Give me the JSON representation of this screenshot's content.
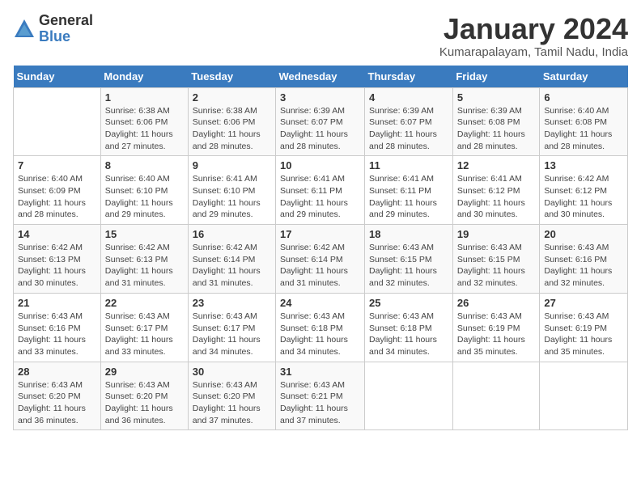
{
  "logo": {
    "text1": "General",
    "text2": "Blue"
  },
  "title": "January 2024",
  "location": "Kumarapalayam, Tamil Nadu, India",
  "weekdays": [
    "Sunday",
    "Monday",
    "Tuesday",
    "Wednesday",
    "Thursday",
    "Friday",
    "Saturday"
  ],
  "days": [
    {
      "date": "",
      "sunrise": "",
      "sunset": "",
      "daylight": ""
    },
    {
      "date": "1",
      "sunrise": "Sunrise: 6:38 AM",
      "sunset": "Sunset: 6:06 PM",
      "daylight": "Daylight: 11 hours and 27 minutes."
    },
    {
      "date": "2",
      "sunrise": "Sunrise: 6:38 AM",
      "sunset": "Sunset: 6:06 PM",
      "daylight": "Daylight: 11 hours and 28 minutes."
    },
    {
      "date": "3",
      "sunrise": "Sunrise: 6:39 AM",
      "sunset": "Sunset: 6:07 PM",
      "daylight": "Daylight: 11 hours and 28 minutes."
    },
    {
      "date": "4",
      "sunrise": "Sunrise: 6:39 AM",
      "sunset": "Sunset: 6:07 PM",
      "daylight": "Daylight: 11 hours and 28 minutes."
    },
    {
      "date": "5",
      "sunrise": "Sunrise: 6:39 AM",
      "sunset": "Sunset: 6:08 PM",
      "daylight": "Daylight: 11 hours and 28 minutes."
    },
    {
      "date": "6",
      "sunrise": "Sunrise: 6:40 AM",
      "sunset": "Sunset: 6:08 PM",
      "daylight": "Daylight: 11 hours and 28 minutes."
    },
    {
      "date": "7",
      "sunrise": "Sunrise: 6:40 AM",
      "sunset": "Sunset: 6:09 PM",
      "daylight": "Daylight: 11 hours and 28 minutes."
    },
    {
      "date": "8",
      "sunrise": "Sunrise: 6:40 AM",
      "sunset": "Sunset: 6:10 PM",
      "daylight": "Daylight: 11 hours and 29 minutes."
    },
    {
      "date": "9",
      "sunrise": "Sunrise: 6:41 AM",
      "sunset": "Sunset: 6:10 PM",
      "daylight": "Daylight: 11 hours and 29 minutes."
    },
    {
      "date": "10",
      "sunrise": "Sunrise: 6:41 AM",
      "sunset": "Sunset: 6:11 PM",
      "daylight": "Daylight: 11 hours and 29 minutes."
    },
    {
      "date": "11",
      "sunrise": "Sunrise: 6:41 AM",
      "sunset": "Sunset: 6:11 PM",
      "daylight": "Daylight: 11 hours and 29 minutes."
    },
    {
      "date": "12",
      "sunrise": "Sunrise: 6:41 AM",
      "sunset": "Sunset: 6:12 PM",
      "daylight": "Daylight: 11 hours and 30 minutes."
    },
    {
      "date": "13",
      "sunrise": "Sunrise: 6:42 AM",
      "sunset": "Sunset: 6:12 PM",
      "daylight": "Daylight: 11 hours and 30 minutes."
    },
    {
      "date": "14",
      "sunrise": "Sunrise: 6:42 AM",
      "sunset": "Sunset: 6:13 PM",
      "daylight": "Daylight: 11 hours and 30 minutes."
    },
    {
      "date": "15",
      "sunrise": "Sunrise: 6:42 AM",
      "sunset": "Sunset: 6:13 PM",
      "daylight": "Daylight: 11 hours and 31 minutes."
    },
    {
      "date": "16",
      "sunrise": "Sunrise: 6:42 AM",
      "sunset": "Sunset: 6:14 PM",
      "daylight": "Daylight: 11 hours and 31 minutes."
    },
    {
      "date": "17",
      "sunrise": "Sunrise: 6:42 AM",
      "sunset": "Sunset: 6:14 PM",
      "daylight": "Daylight: 11 hours and 31 minutes."
    },
    {
      "date": "18",
      "sunrise": "Sunrise: 6:43 AM",
      "sunset": "Sunset: 6:15 PM",
      "daylight": "Daylight: 11 hours and 32 minutes."
    },
    {
      "date": "19",
      "sunrise": "Sunrise: 6:43 AM",
      "sunset": "Sunset: 6:15 PM",
      "daylight": "Daylight: 11 hours and 32 minutes."
    },
    {
      "date": "20",
      "sunrise": "Sunrise: 6:43 AM",
      "sunset": "Sunset: 6:16 PM",
      "daylight": "Daylight: 11 hours and 32 minutes."
    },
    {
      "date": "21",
      "sunrise": "Sunrise: 6:43 AM",
      "sunset": "Sunset: 6:16 PM",
      "daylight": "Daylight: 11 hours and 33 minutes."
    },
    {
      "date": "22",
      "sunrise": "Sunrise: 6:43 AM",
      "sunset": "Sunset: 6:17 PM",
      "daylight": "Daylight: 11 hours and 33 minutes."
    },
    {
      "date": "23",
      "sunrise": "Sunrise: 6:43 AM",
      "sunset": "Sunset: 6:17 PM",
      "daylight": "Daylight: 11 hours and 34 minutes."
    },
    {
      "date": "24",
      "sunrise": "Sunrise: 6:43 AM",
      "sunset": "Sunset: 6:18 PM",
      "daylight": "Daylight: 11 hours and 34 minutes."
    },
    {
      "date": "25",
      "sunrise": "Sunrise: 6:43 AM",
      "sunset": "Sunset: 6:18 PM",
      "daylight": "Daylight: 11 hours and 34 minutes."
    },
    {
      "date": "26",
      "sunrise": "Sunrise: 6:43 AM",
      "sunset": "Sunset: 6:19 PM",
      "daylight": "Daylight: 11 hours and 35 minutes."
    },
    {
      "date": "27",
      "sunrise": "Sunrise: 6:43 AM",
      "sunset": "Sunset: 6:19 PM",
      "daylight": "Daylight: 11 hours and 35 minutes."
    },
    {
      "date": "28",
      "sunrise": "Sunrise: 6:43 AM",
      "sunset": "Sunset: 6:20 PM",
      "daylight": "Daylight: 11 hours and 36 minutes."
    },
    {
      "date": "29",
      "sunrise": "Sunrise: 6:43 AM",
      "sunset": "Sunset: 6:20 PM",
      "daylight": "Daylight: 11 hours and 36 minutes."
    },
    {
      "date": "30",
      "sunrise": "Sunrise: 6:43 AM",
      "sunset": "Sunset: 6:20 PM",
      "daylight": "Daylight: 11 hours and 37 minutes."
    },
    {
      "date": "31",
      "sunrise": "Sunrise: 6:43 AM",
      "sunset": "Sunset: 6:21 PM",
      "daylight": "Daylight: 11 hours and 37 minutes."
    }
  ]
}
